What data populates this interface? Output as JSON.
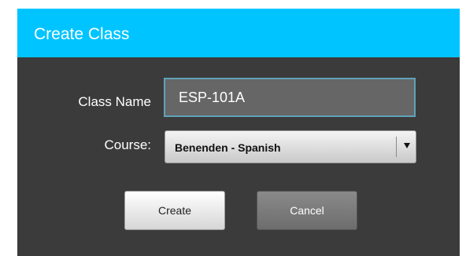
{
  "dialog": {
    "title": "Create Class",
    "class_name": {
      "label": "Class Name",
      "value": "ESP-101A"
    },
    "course": {
      "label": "Course:",
      "selected": "Benenden - Spanish"
    },
    "buttons": {
      "create": "Create",
      "cancel": "Cancel"
    }
  },
  "colors": {
    "title_bar": "#00c4ff",
    "dialog_background": "#3b3b3b",
    "input_background": "#666666",
    "input_border": "#5fa3b8"
  },
  "icons": {
    "dropdown": "chevron-down-icon"
  }
}
